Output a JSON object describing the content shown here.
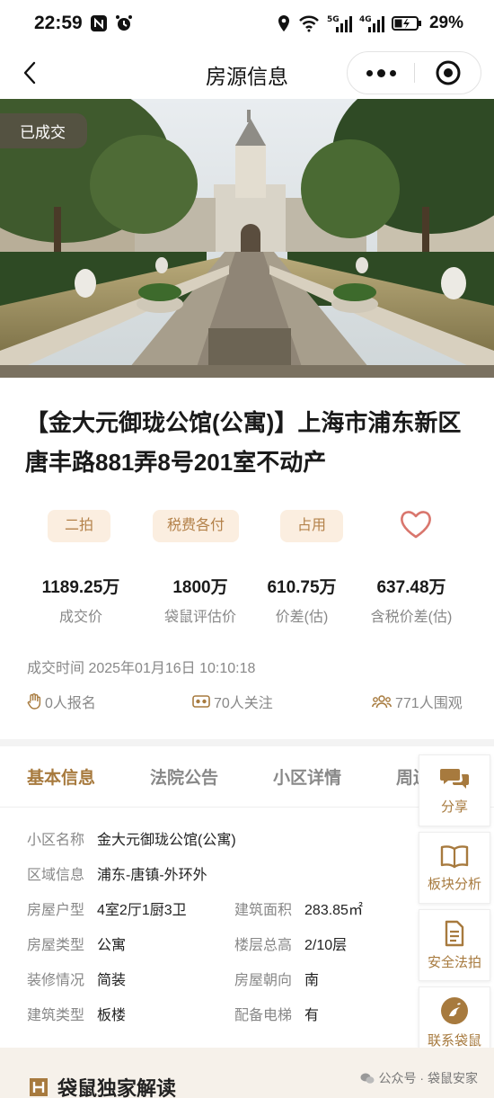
{
  "status_bar": {
    "time": "22:59",
    "battery": "29%",
    "net_1": "5G",
    "net_2": "4G"
  },
  "nav": {
    "title": "房源信息"
  },
  "hero": {
    "badge": "已成交"
  },
  "listing": {
    "title": "【金大元御珑公馆(公寓)】上海市浦东新区唐丰路881弄8号201室不动产",
    "tags": [
      "二拍",
      "税费各付",
      "占用"
    ],
    "stats": [
      {
        "value": "1189.25万",
        "label": "成交价"
      },
      {
        "value": "1800万",
        "label": "袋鼠评估价"
      },
      {
        "value": "610.75万",
        "label": "价差(估)"
      },
      {
        "value": "637.48万",
        "label": "含税价差(估)"
      }
    ],
    "deal_time": "成交时间 2025年01月16日 10:10:18",
    "signups": "0人报名",
    "followers": "70人关注",
    "watchers": "771人围观"
  },
  "tabs": [
    "基本信息",
    "法院公告",
    "小区详情",
    "周边"
  ],
  "info": {
    "community_k": "小区名称",
    "community_v": "金大元御珑公馆(公寓)",
    "area_k": "区域信息",
    "area_v": "浦东-唐镇-外环外",
    "layout_k": "房屋户型",
    "layout_v": "4室2厅1厨3卫",
    "size_k": "建筑面积",
    "size_v": "283.85㎡",
    "type_k": "房屋类型",
    "type_v": "公寓",
    "floor_k": "楼层总高",
    "floor_v": "2/10层",
    "decor_k": "装修情况",
    "decor_v": "简装",
    "orient_k": "房屋朝向",
    "orient_v": "南",
    "build_k": "建筑类型",
    "build_v": "板楼",
    "elevator_k": "配备电梯",
    "elevator_v": "有"
  },
  "side_panel": [
    "分享",
    "板块分析",
    "安全法拍",
    "联系袋鼠"
  ],
  "bottom": {
    "section_title": "袋鼠独家解读",
    "watermark": "公众号 · 袋鼠安家"
  },
  "colors": {
    "accent": "#a77a3e",
    "tag_bg": "#fbeee0",
    "heart": "#d9766d"
  }
}
